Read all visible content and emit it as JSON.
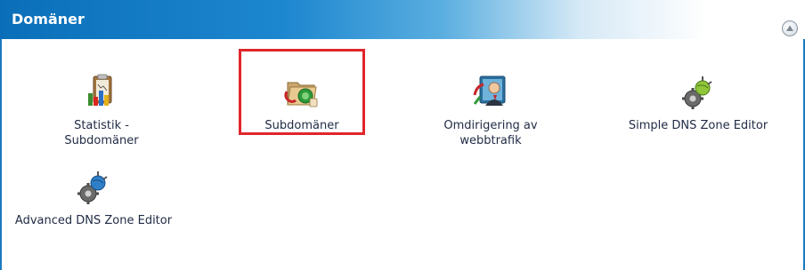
{
  "panel": {
    "title": "Domäner",
    "collapse_icon": "collapse-up-icon"
  },
  "items": [
    {
      "label": "Statistik - Subdomäner",
      "icon": "statistics-icon"
    },
    {
      "label": "Subdomäner",
      "icon": "folder-globe-icon"
    },
    {
      "label": "Omdirigering av webbtrafik",
      "icon": "redirect-user-icon"
    },
    {
      "label": "Simple DNS Zone Editor",
      "icon": "dns-gear-icon"
    },
    {
      "label": "Advanced DNS Zone Editor",
      "icon": "advanced-dns-gear-icon"
    }
  ],
  "highlight_color": "#e0262b",
  "accent_color": "#0a6fb8"
}
